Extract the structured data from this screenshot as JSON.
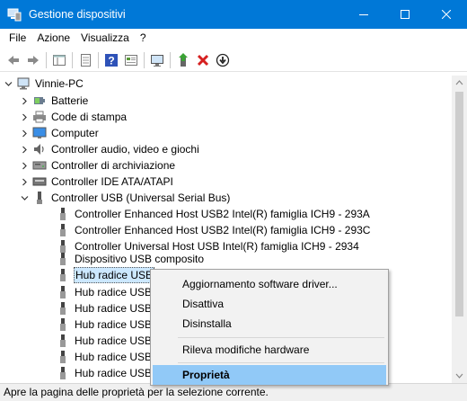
{
  "window": {
    "title": "Gestione dispositivi",
    "accent": "#0078d7",
    "controls": [
      "minimize-icon",
      "maximize-icon",
      "close-icon"
    ]
  },
  "menubar": [
    "File",
    "Azione",
    "Visualizza",
    "?"
  ],
  "toolbar": {
    "buttons": [
      "back-arrow-icon",
      "forward-arrow-icon",
      "show-hide-tree-icon",
      "properties-icon",
      "help-icon",
      "view-icon",
      "monitor-scan-icon",
      "update-driver-icon",
      "disable-x-icon",
      "uninstall-down-icon"
    ]
  },
  "tree": {
    "root": "Vinnie-PC",
    "categories": [
      {
        "label": "Batterie",
        "icon": "battery-icon",
        "expanded": false
      },
      {
        "label": "Code di stampa",
        "icon": "printer-icon",
        "expanded": false
      },
      {
        "label": "Computer",
        "icon": "computer-icon",
        "expanded": false
      },
      {
        "label": "Controller audio, video e giochi",
        "icon": "speaker-icon",
        "expanded": false
      },
      {
        "label": "Controller di archiviazione",
        "icon": "storage-icon",
        "expanded": false
      },
      {
        "label": "Controller IDE ATA/ATAPI",
        "icon": "ide-icon",
        "expanded": false
      },
      {
        "label": "Controller USB (Universal Serial Bus)",
        "icon": "usb-controller-icon",
        "expanded": true
      }
    ],
    "usb_children": [
      "Controller Enhanced Host USB2 Intel(R) famiglia ICH9 - 293A",
      "Controller Enhanced Host USB2 Intel(R) famiglia ICH9 - 293C",
      "Controller Universal Host USB Intel(R) famiglia ICH9 - 2934",
      "Dispositivo USB composito",
      "Hub radice USB",
      "Hub radice USB",
      "Hub radice USB",
      "Hub radice USB",
      "Hub radice USB",
      "Hub radice USB",
      "Hub radice USB"
    ]
  },
  "context_menu": {
    "items": [
      "Aggiornamento software driver...",
      "Disattiva",
      "Disinstalla",
      "Rileva modifiche hardware",
      "Proprietà"
    ],
    "highlighted": "Proprietà",
    "highlight_color": "#91c9f7"
  },
  "statusbar": {
    "text": "Apre la pagina delle proprietà per la selezione corrente."
  }
}
